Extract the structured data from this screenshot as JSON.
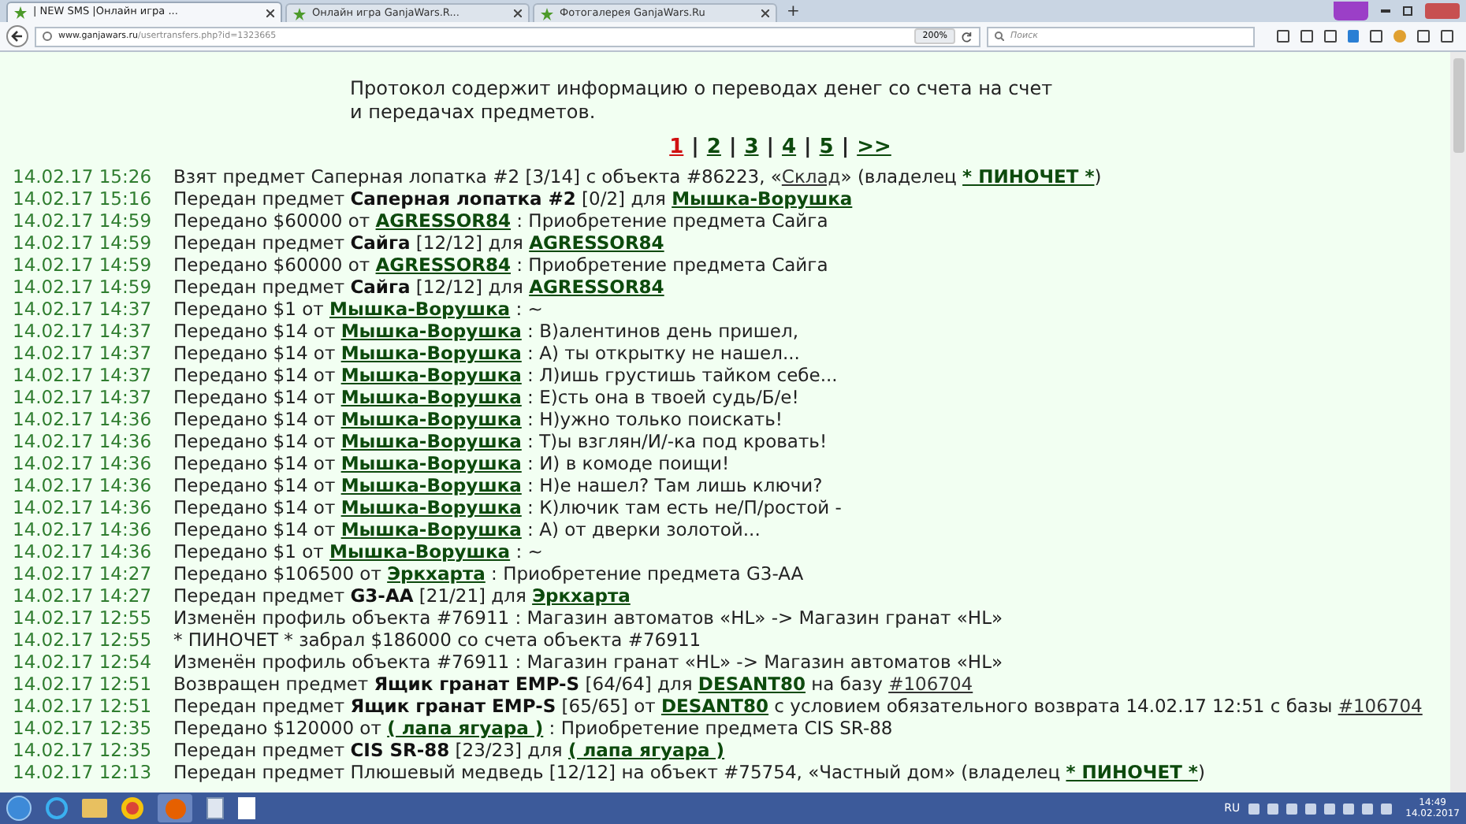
{
  "browser": {
    "tabs": [
      {
        "label": "| NEW SMS |Онлайн игра ...",
        "selected": true
      },
      {
        "label": "Онлайн игра GanjaWars.R...",
        "selected": false
      },
      {
        "label": "Фотогалерея GanjaWars.Ru",
        "selected": false
      }
    ],
    "new_tab": "+",
    "url_host": "www.ganjawars.ru",
    "url_path": "/usertransfers.php?id=1323665",
    "zoom": "200%",
    "search": {
      "placeholder": "Поиск"
    }
  },
  "intro": "Протокол содержит информацию о переводах денег со счета на счет и передачах предметов.",
  "pages": [
    {
      "label": "1",
      "selected": true
    },
    {
      "label": "2",
      "selected": false
    },
    {
      "label": "3",
      "selected": false
    },
    {
      "label": "4",
      "selected": false
    },
    {
      "label": "5",
      "selected": false
    },
    {
      "label": ">>",
      "selected": false
    }
  ],
  "separator": "|",
  "log": [
    {
      "date": "14.02.17 15:26",
      "parts": [
        {
          "kind": "text",
          "text": "Взят предмет Саперная лопатка #2 [3/14] с объекта #86223, «"
        },
        {
          "kind": "ulink",
          "text": "Склад"
        },
        {
          "kind": "text",
          "text": "» (владелец "
        },
        {
          "kind": "link",
          "text": "* ПИНОЧЕТ *"
        },
        {
          "kind": "text",
          "text": ")"
        }
      ]
    },
    {
      "date": "14.02.17 15:16",
      "parts": [
        {
          "kind": "text",
          "text": "Передан предмет "
        },
        {
          "kind": "bold",
          "text": "Саперная лопатка #2"
        },
        {
          "kind": "text",
          "text": " [0/2] для "
        },
        {
          "kind": "link",
          "text": "Мышка-Ворушка"
        }
      ]
    },
    {
      "date": "14.02.17 14:59",
      "parts": [
        {
          "kind": "text",
          "text": "Передано $60000 от "
        },
        {
          "kind": "link",
          "text": "AGRESSOR84"
        },
        {
          "kind": "text",
          "text": " : Приобретение предмета Сайга"
        }
      ]
    },
    {
      "date": "14.02.17 14:59",
      "parts": [
        {
          "kind": "text",
          "text": "Передан предмет "
        },
        {
          "kind": "bold",
          "text": "Сайга"
        },
        {
          "kind": "text",
          "text": " [12/12] для "
        },
        {
          "kind": "link",
          "text": "AGRESSOR84"
        }
      ]
    },
    {
      "date": "14.02.17 14:59",
      "parts": [
        {
          "kind": "text",
          "text": "Передано $60000 от "
        },
        {
          "kind": "link",
          "text": "AGRESSOR84"
        },
        {
          "kind": "text",
          "text": " : Приобретение предмета Сайга"
        }
      ]
    },
    {
      "date": "14.02.17 14:59",
      "parts": [
        {
          "kind": "text",
          "text": "Передан предмет "
        },
        {
          "kind": "bold",
          "text": "Сайга"
        },
        {
          "kind": "text",
          "text": " [12/12] для "
        },
        {
          "kind": "link",
          "text": "AGRESSOR84"
        }
      ]
    },
    {
      "date": "14.02.17 14:37",
      "parts": [
        {
          "kind": "text",
          "text": "Передано $1 от "
        },
        {
          "kind": "link",
          "text": "Мышка-Ворушка"
        },
        {
          "kind": "text",
          "text": " : ~"
        }
      ]
    },
    {
      "date": "14.02.17 14:37",
      "parts": [
        {
          "kind": "text",
          "text": "Передано $14 от "
        },
        {
          "kind": "link",
          "text": "Мышка-Ворушка"
        },
        {
          "kind": "text",
          "text": " : В)алентинов день пришел,"
        }
      ]
    },
    {
      "date": "14.02.17 14:37",
      "parts": [
        {
          "kind": "text",
          "text": "Передано $14 от "
        },
        {
          "kind": "link",
          "text": "Мышка-Ворушка"
        },
        {
          "kind": "text",
          "text": " : А) ты открытку не нашел..."
        }
      ]
    },
    {
      "date": "14.02.17 14:37",
      "parts": [
        {
          "kind": "text",
          "text": "Передано $14 от "
        },
        {
          "kind": "link",
          "text": "Мышка-Ворушка"
        },
        {
          "kind": "text",
          "text": " : Л)ишь грустишь тайком себе..."
        }
      ]
    },
    {
      "date": "14.02.17 14:37",
      "parts": [
        {
          "kind": "text",
          "text": "Передано $14 от "
        },
        {
          "kind": "link",
          "text": "Мышка-Ворушка"
        },
        {
          "kind": "text",
          "text": " : Е)сть она в твоей судь/Б/е!"
        }
      ]
    },
    {
      "date": "14.02.17 14:36",
      "parts": [
        {
          "kind": "text",
          "text": "Передано $14 от "
        },
        {
          "kind": "link",
          "text": "Мышка-Ворушка"
        },
        {
          "kind": "text",
          "text": " : Н)ужно только поискать!"
        }
      ]
    },
    {
      "date": "14.02.17 14:36",
      "parts": [
        {
          "kind": "text",
          "text": "Передано $14 от "
        },
        {
          "kind": "link",
          "text": "Мышка-Ворушка"
        },
        {
          "kind": "text",
          "text": " : Т)ы взглян/И/-ка под кровать!"
        }
      ]
    },
    {
      "date": "14.02.17 14:36",
      "parts": [
        {
          "kind": "text",
          "text": "Передано $14 от "
        },
        {
          "kind": "link",
          "text": "Мышка-Ворушка"
        },
        {
          "kind": "text",
          "text": " : И) в комоде поищи!"
        }
      ]
    },
    {
      "date": "14.02.17 14:36",
      "parts": [
        {
          "kind": "text",
          "text": "Передано $14 от "
        },
        {
          "kind": "link",
          "text": "Мышка-Ворушка"
        },
        {
          "kind": "text",
          "text": " : Н)е нашел? Там лишь ключи?"
        }
      ]
    },
    {
      "date": "14.02.17 14:36",
      "parts": [
        {
          "kind": "text",
          "text": "Передано $14 от "
        },
        {
          "kind": "link",
          "text": "Мышка-Ворушка"
        },
        {
          "kind": "text",
          "text": " : К)лючик там есть не/П/ростой -"
        }
      ]
    },
    {
      "date": "14.02.17 14:36",
      "parts": [
        {
          "kind": "text",
          "text": "Передано $14 от "
        },
        {
          "kind": "link",
          "text": "Мышка-Ворушка"
        },
        {
          "kind": "text",
          "text": " : А) от дверки золотой..."
        }
      ]
    },
    {
      "date": "14.02.17 14:36",
      "parts": [
        {
          "kind": "text",
          "text": "Передано $1 от "
        },
        {
          "kind": "link",
          "text": "Мышка-Ворушка"
        },
        {
          "kind": "text",
          "text": " : ~"
        }
      ]
    },
    {
      "date": "14.02.17 14:27",
      "parts": [
        {
          "kind": "text",
          "text": "Передано $106500 от "
        },
        {
          "kind": "link",
          "text": "Эркхарта"
        },
        {
          "kind": "text",
          "text": " : Приобретение предмета G3-AA"
        }
      ]
    },
    {
      "date": "14.02.17 14:27",
      "parts": [
        {
          "kind": "text",
          "text": "Передан предмет "
        },
        {
          "kind": "bold",
          "text": "G3-AA"
        },
        {
          "kind": "text",
          "text": " [21/21] для "
        },
        {
          "kind": "link",
          "text": "Эркхарта"
        }
      ]
    },
    {
      "date": "14.02.17 12:55",
      "parts": [
        {
          "kind": "text",
          "text": "Изменён профиль объекта #76911 : Магазин автоматов «HL» -> Магазин гранат «HL»"
        }
      ]
    },
    {
      "date": "14.02.17 12:55",
      "parts": [
        {
          "kind": "text",
          "text": "* ПИНОЧЕТ * забрал $186000 со счета объекта #76911"
        }
      ]
    },
    {
      "date": "14.02.17 12:54",
      "parts": [
        {
          "kind": "text",
          "text": "Изменён профиль объекта #76911 : Магазин гранат «HL» -> Магазин автоматов «HL»"
        }
      ]
    },
    {
      "date": "14.02.17 12:51",
      "parts": [
        {
          "kind": "text",
          "text": "Возвращен предмет "
        },
        {
          "kind": "bold",
          "text": "Ящик гранат EMP-S"
        },
        {
          "kind": "text",
          "text": " [64/64] для "
        },
        {
          "kind": "link",
          "text": "DESANT80"
        },
        {
          "kind": "text",
          "text": " на базу "
        },
        {
          "kind": "ulink",
          "text": "#106704"
        }
      ]
    },
    {
      "date": "14.02.17 12:51",
      "parts": [
        {
          "kind": "text",
          "text": "Передан предмет "
        },
        {
          "kind": "bold",
          "text": "Ящик гранат EMP-S"
        },
        {
          "kind": "text",
          "text": " [65/65] от "
        },
        {
          "kind": "link",
          "text": "DESANT80"
        },
        {
          "kind": "text",
          "text": " с условием обязательного возврата 14.02.17 12:51 с базы "
        },
        {
          "kind": "ulink",
          "text": "#106704"
        }
      ]
    },
    {
      "date": "14.02.17 12:35",
      "parts": [
        {
          "kind": "text",
          "text": "Передано $120000 от "
        },
        {
          "kind": "link",
          "text": "( лапа ягуара )"
        },
        {
          "kind": "text",
          "text": " : Приобретение предмета CIS SR-88"
        }
      ]
    },
    {
      "date": "14.02.17 12:35",
      "parts": [
        {
          "kind": "text",
          "text": "Передан предмет "
        },
        {
          "kind": "bold",
          "text": "CIS SR-88"
        },
        {
          "kind": "text",
          "text": " [23/23] для "
        },
        {
          "kind": "link",
          "text": "( лапа ягуара )"
        }
      ]
    },
    {
      "date": "14.02.17 12:13",
      "parts": [
        {
          "kind": "text",
          "text": "Передан предмет Плюшевый медведь [12/12] на объект #75754, «Частный дом» (владелец "
        },
        {
          "kind": "link",
          "text": "* ПИНОЧЕТ *"
        },
        {
          "kind": "text",
          "text": ")"
        }
      ]
    }
  ],
  "taskbar": {
    "language": "RU",
    "time": "14:49",
    "date": "14.02.2017"
  }
}
